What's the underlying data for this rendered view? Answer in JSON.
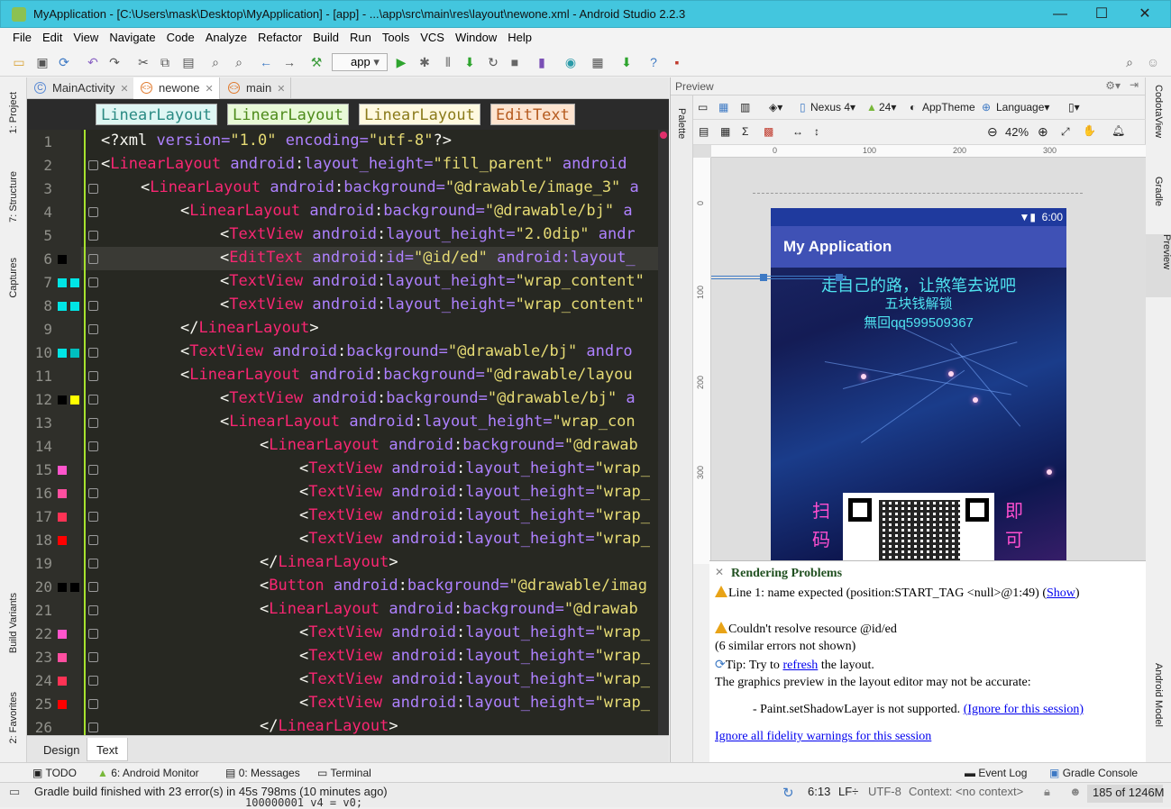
{
  "window": {
    "title": "MyApplication - [C:\\Users\\mask\\Desktop\\MyApplication] - [app] - ...\\app\\src\\main\\res\\layout\\newone.xml - Android Studio 2.2.3",
    "minimize": "—",
    "maximize": "☐",
    "close": "✕"
  },
  "menu": [
    "File",
    "Edit",
    "View",
    "Navigate",
    "Code",
    "Analyze",
    "Refactor",
    "Build",
    "Run",
    "Tools",
    "VCS",
    "Window",
    "Help"
  ],
  "toolbar": {
    "run_config": "app"
  },
  "left_tools": {
    "project": "1: Project",
    "structure": "7: Structure",
    "captures": "Captures",
    "build_variants": "Build Variants",
    "favorites": "2: Favorites"
  },
  "right_tools": {
    "codota": "CodotaView",
    "gradle": "Gradle",
    "preview": "Preview",
    "android_model": "Android Model"
  },
  "tabs": [
    {
      "label": "MainActivity",
      "icon": "C"
    },
    {
      "label": "newone",
      "icon": "<>"
    },
    {
      "label": "main",
      "icon": "<>"
    }
  ],
  "breadcrumbs": [
    "LinearLayout",
    "LinearLayout",
    "LinearLayout",
    "EditText"
  ],
  "editor": {
    "line_numbers": [
      "1",
      "2",
      "3",
      "4",
      "5",
      "6",
      "7",
      "8",
      "9",
      "10",
      "11",
      "12",
      "13",
      "14",
      "15",
      "16",
      "17",
      "18",
      "19",
      "20",
      "21",
      "22",
      "23",
      "24",
      "25",
      "26"
    ],
    "lines": [
      {
        "indent": 0,
        "t": "<",
        "tag": "?xml",
        "rest": " version=\"1.0\" encoding=\"utf-8\"?>"
      },
      {
        "indent": 0,
        "t": "<",
        "tag": "LinearLayout",
        "attr": "android:layout_height=",
        "val": "\"fill_parent\"",
        "more": " android"
      },
      {
        "indent": 1,
        "t": "<",
        "tag": "LinearLayout",
        "attr": "android:background=",
        "val": "\"@drawable/image_3\"",
        "more": " a"
      },
      {
        "indent": 2,
        "t": "<",
        "tag": "LinearLayout",
        "attr": "android:background=",
        "val": "\"@drawable/bj\"",
        "more": " a"
      },
      {
        "indent": 3,
        "t": "<",
        "tag": "TextView",
        "attr": "android:layout_height=",
        "val": "\"2.0dip\"",
        "more": " andr"
      },
      {
        "indent": 3,
        "t": "<",
        "tag": "EditText",
        "attr": "android:id=",
        "val": "\"@id/ed\"",
        "more": " android:layout_"
      },
      {
        "indent": 3,
        "t": "<",
        "tag": "TextView",
        "attr": "android:layout_height=",
        "val": "\"wrap_content\"",
        "more": ""
      },
      {
        "indent": 3,
        "t": "<",
        "tag": "TextView",
        "attr": "android:layout_height=",
        "val": "\"wrap_content\"",
        "more": ""
      },
      {
        "indent": 2,
        "t": "</",
        "tag": "LinearLayout",
        "attr": "",
        "val": "",
        "more": ">"
      },
      {
        "indent": 2,
        "t": "<",
        "tag": "TextView",
        "attr": "android:background=",
        "val": "\"@drawable/bj\"",
        "more": " andro"
      },
      {
        "indent": 2,
        "t": "<",
        "tag": "LinearLayout",
        "attr": "android:background=",
        "val": "\"@drawable/layou",
        "more": ""
      },
      {
        "indent": 3,
        "t": "<",
        "tag": "TextView",
        "attr": "android:background=",
        "val": "\"@drawable/bj\"",
        "more": " a"
      },
      {
        "indent": 3,
        "t": "<",
        "tag": "LinearLayout",
        "attr": "android:layout_height=",
        "val": "\"wrap_con",
        "more": ""
      },
      {
        "indent": 4,
        "t": "<",
        "tag": "LinearLayout",
        "attr": "android:background=",
        "val": "\"@drawab",
        "more": ""
      },
      {
        "indent": 5,
        "t": "<",
        "tag": "TextView",
        "attr": "android:layout_height=",
        "val": "\"wrap_",
        "more": ""
      },
      {
        "indent": 5,
        "t": "<",
        "tag": "TextView",
        "attr": "android:layout_height=",
        "val": "\"wrap_",
        "more": ""
      },
      {
        "indent": 5,
        "t": "<",
        "tag": "TextView",
        "attr": "android:layout_height=",
        "val": "\"wrap_",
        "more": ""
      },
      {
        "indent": 5,
        "t": "<",
        "tag": "TextView",
        "attr": "android:layout_height=",
        "val": "\"wrap_",
        "more": ""
      },
      {
        "indent": 4,
        "t": "</",
        "tag": "LinearLayout",
        "attr": "",
        "val": "",
        "more": ">"
      },
      {
        "indent": 4,
        "t": "<",
        "tag": "Button",
        "attr": "android:background=",
        "val": "\"@drawable/imag",
        "more": ""
      },
      {
        "indent": 4,
        "t": "<",
        "tag": "LinearLayout",
        "attr": "android:background=",
        "val": "\"@drawab",
        "more": ""
      },
      {
        "indent": 5,
        "t": "<",
        "tag": "TextView",
        "attr": "android:layout_height=",
        "val": "\"wrap_",
        "more": ""
      },
      {
        "indent": 5,
        "t": "<",
        "tag": "TextView",
        "attr": "android:layout_height=",
        "val": "\"wrap_",
        "more": ""
      },
      {
        "indent": 5,
        "t": "<",
        "tag": "TextView",
        "attr": "android:layout_height=",
        "val": "\"wrap_",
        "more": ""
      },
      {
        "indent": 5,
        "t": "<",
        "tag": "TextView",
        "attr": "android:layout_height=",
        "val": "\"wrap_",
        "more": ""
      },
      {
        "indent": 4,
        "t": "</",
        "tag": "LinearLayout",
        "attr": "",
        "val": "",
        "more": ">"
      }
    ],
    "swatches": {
      "6": [
        "#000000"
      ],
      "7": [
        "#00e5e5",
        "#00e5e5"
      ],
      "8": [
        "#00e5e5",
        "#00e5e5"
      ],
      "10": [
        "#00e5e5",
        "#00bfbf"
      ],
      "12": [
        "#000000",
        "#ffff00"
      ],
      "15": [
        "#ff55cc"
      ],
      "16": [
        "#ff4fa0"
      ],
      "17": [
        "#ff3355"
      ],
      "18": [
        "#ff0000"
      ],
      "20": [
        "#000000",
        "#000000"
      ],
      "22": [
        "#ff55cc"
      ],
      "23": [
        "#ff4fa0"
      ],
      "24": [
        "#ff3355"
      ],
      "25": [
        "#ff0000"
      ]
    }
  },
  "design_tabs": {
    "design": "Design",
    "text": "Text"
  },
  "preview": {
    "header": "Preview",
    "palette": "Palette",
    "device": "Nexus 4",
    "api": "24",
    "theme": "AppTheme",
    "language": "Language",
    "zoom": "42%",
    "ruler_top": [
      "0",
      "100",
      "200",
      "300"
    ],
    "ruler_left": [
      "0",
      "100",
      "200",
      "300"
    ],
    "phone": {
      "time": "6:00",
      "app_title": "My Application",
      "line1": "走自己的路，让煞笔去说吧",
      "line2": "五块钱解锁",
      "line3": "無回qq599509367",
      "left_chars": [
        "扫",
        "码"
      ],
      "right_chars": [
        "即",
        "可"
      ]
    }
  },
  "problems": {
    "title": "Rendering Problems",
    "l1": "Line 1: name expected (position:START_TAG <null>@1:49) (",
    "l1_link": "Show",
    "l1_end": ")",
    "l2": "Couldn't resolve resource @id/ed",
    "l3": "(6 similar errors not shown)",
    "l4a": "Tip: Try to ",
    "l4_link": "refresh",
    "l4b": " the layout.",
    "l5": "The graphics preview in the layout editor may not be accurate:",
    "l6": "- Paint.setShadowLayer is not supported. ",
    "l6_link": "(Ignore for this session)",
    "l7_link": "Ignore all fidelity warnings for this session"
  },
  "bottom_tools": {
    "todo": "TODO",
    "monitor": "6: Android Monitor",
    "messages": "0: Messages",
    "terminal": "Terminal",
    "event_log": "Event Log",
    "gradle_console": "Gradle Console"
  },
  "status": {
    "message": "Gradle build finished with 23 error(s) in 45s 798ms (10 minutes ago)",
    "behind": "100000001 v4 = v0;",
    "position": "6:13",
    "line_sep": "LF÷",
    "encoding": "UTF-8",
    "context": "Context: <no context>",
    "memory": "185 of 1246M"
  }
}
